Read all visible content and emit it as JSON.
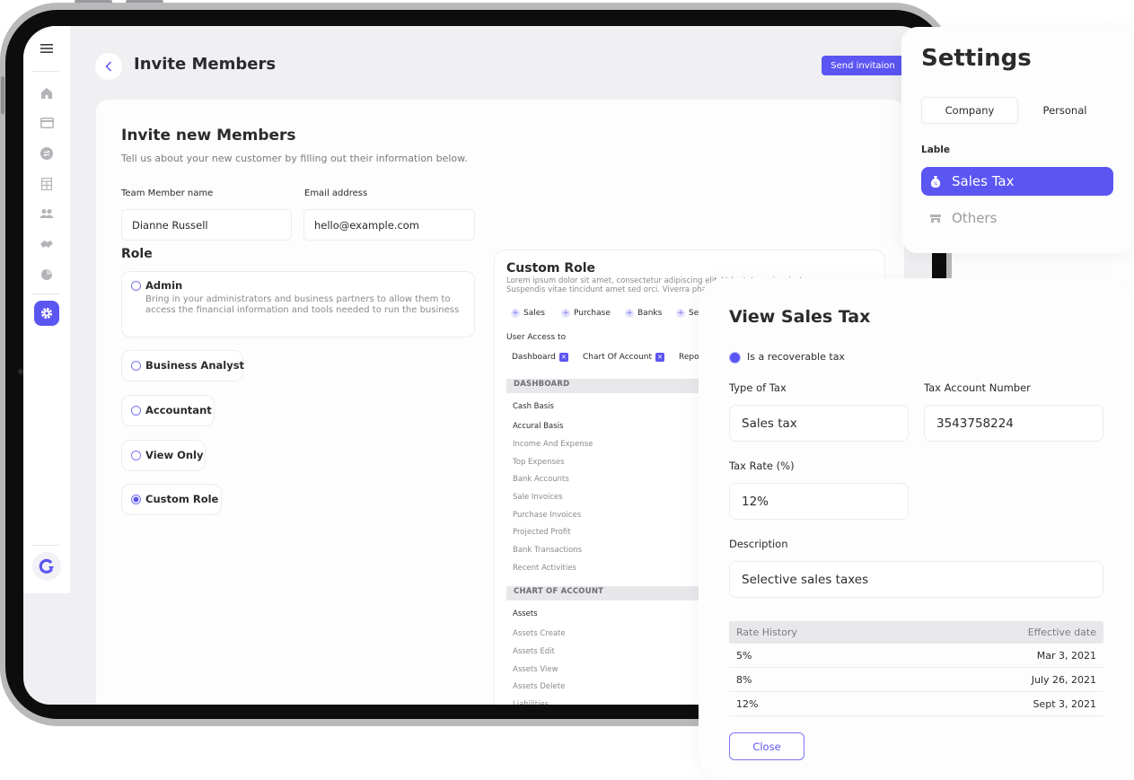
{
  "header": {
    "title": "Invite Members",
    "send_button": "Send invitaion"
  },
  "sidebar": {
    "items": [
      {
        "icon": "menu-icon"
      },
      {
        "icon": "home-icon"
      },
      {
        "icon": "credit-card-icon"
      },
      {
        "icon": "exchange-icon"
      },
      {
        "icon": "table-grid-icon"
      },
      {
        "icon": "users-icon"
      },
      {
        "icon": "handshake-icon"
      },
      {
        "icon": "pie-chart-icon"
      },
      {
        "icon": "gear-icon",
        "active": true
      }
    ],
    "logo": "brand-logo-icon"
  },
  "invite_form": {
    "title": "Invite new  Members",
    "subtitle": "Tell us about your new customer by filling out their information below.",
    "name_label": "Team Member name",
    "name_value": "Dianne Russell",
    "email_label": "Email address",
    "email_value": "hello@example.com",
    "role_heading": "Role",
    "roles": [
      {
        "label": "Admin",
        "description": "Bring in your administrators and business partners to allow them to access the financial information and tools needed to run the business",
        "checked": false
      },
      {
        "label": "Business Analyst",
        "checked": false
      },
      {
        "label": "Accountant",
        "checked": false
      },
      {
        "label": "View Only",
        "checked": false
      },
      {
        "label": "Custom Role",
        "checked": true
      }
    ]
  },
  "custom_role": {
    "title": "Custom Role",
    "description": "Lorem ipsum dolor sit amet, consectetur adipiscing elit. Vulputate orci ac justo purus. Suspendis vitae tincidunt amet sed orci. Viverra phasellus gravida",
    "modules": [
      "Sales",
      "Purchase",
      "Banks",
      "Settings"
    ],
    "user_access_label": "User Access to",
    "access": [
      "Dashboard",
      "Chart Of Account",
      "Reports"
    ],
    "sections": [
      {
        "heading": "DASHBOARD",
        "items": [
          {
            "label": "Cash Basis",
            "strong": true
          },
          {
            "label": "Accural Basis",
            "strong": true
          },
          {
            "label": "Income And Expense"
          },
          {
            "label": "Top Expenses"
          },
          {
            "label": "Bank Accounts"
          },
          {
            "label": "Sale Invoices"
          },
          {
            "label": "Purchase Invoices"
          },
          {
            "label": "Projected Profit"
          },
          {
            "label": "Bank Transactions"
          },
          {
            "label": "Recent Activities"
          }
        ]
      },
      {
        "heading": "CHART OF ACCOUNT",
        "items": [
          {
            "label": "Assets",
            "strong": true
          },
          {
            "label": "Assets Create"
          },
          {
            "label": "Assets Edit"
          },
          {
            "label": "Assets View"
          },
          {
            "label": "Assets Delete"
          },
          {
            "label": "Liabilities"
          }
        ]
      }
    ]
  },
  "settings": {
    "title": "Settings",
    "tabs": [
      {
        "label": "Company",
        "active": true
      },
      {
        "label": "Personal",
        "active": false
      }
    ],
    "section_label": "Lable",
    "items": [
      {
        "label": "Sales Tax",
        "icon": "money-bag-icon",
        "active": true
      },
      {
        "label": "Others",
        "icon": "store-icon",
        "active": false
      }
    ]
  },
  "sales_tax": {
    "title": "View Sales Tax",
    "recoverable_label": "Is a recoverable tax",
    "recoverable_checked": true,
    "type_label": "Type of Tax",
    "type_value": "Sales tax",
    "account_label": "Tax Account Number",
    "account_value": "3543758224",
    "rate_label": "Tax Rate (%)",
    "rate_value": "12%",
    "description_label": "Description",
    "description_value": "Selective sales taxes",
    "history": {
      "columns": [
        "Rate History",
        "Effective date"
      ],
      "rows": [
        {
          "rate": "5%",
          "date": "Mar 3, 2021"
        },
        {
          "rate": "8%",
          "date": "July 26, 2021"
        },
        {
          "rate": "12%",
          "date": "Sept 3, 2021"
        }
      ]
    },
    "close_button": "Close"
  },
  "colors": {
    "accent": "#5b55f2",
    "background": "#f0f0f3",
    "text": "#2b2b2e",
    "muted": "#8a8a90"
  }
}
